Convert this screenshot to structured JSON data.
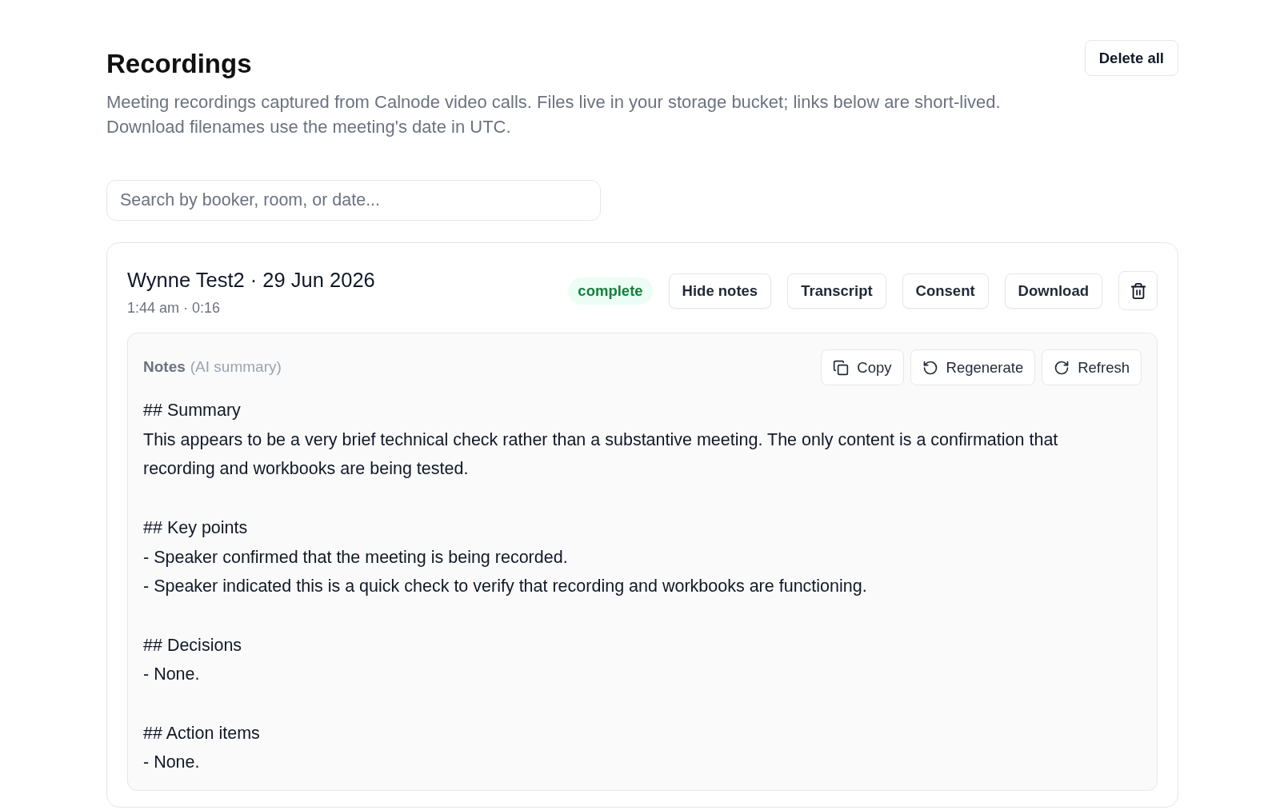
{
  "page": {
    "title": "Recordings",
    "description": "Meeting recordings captured from Calnode video calls. Files live in your storage bucket; links below are short-lived.\nDownload filenames use the meeting's date in UTC.",
    "delete_all_button": "Delete all"
  },
  "search": {
    "placeholder": "Search by booker, room, or date..."
  },
  "recordings": [
    {
      "title": "Wynne Test2 · 29 Jun 2026",
      "meta": "1:44 am · 0:16",
      "status": "complete",
      "actions": [
        "Hide notes",
        "Transcript",
        "Consent",
        "Download"
      ],
      "notes": {
        "label": "Notes",
        "sublabel": "(AI summary)",
        "actions": [
          {
            "kind": "copy",
            "label": "Copy"
          },
          {
            "kind": "regenerate",
            "label": "Regenerate"
          },
          {
            "kind": "refresh",
            "label": "Refresh"
          }
        ],
        "sections": [
          {
            "heading": "## Summary",
            "lines": [
              "This appears to be a very brief technical check rather than a substantive meeting. The only content is a confirmation that recording and workbooks are being tested."
            ]
          },
          {
            "heading": "## Key points",
            "lines": [
              "- Speaker confirmed that the meeting is being recorded.",
              "- Speaker indicated this is a quick check to verify that recording and workbooks are functioning."
            ]
          },
          {
            "heading": "## Decisions",
            "lines": [
              "- None."
            ]
          },
          {
            "heading": "## Action items",
            "lines": [
              "- None."
            ]
          }
        ]
      }
    }
  ]
}
